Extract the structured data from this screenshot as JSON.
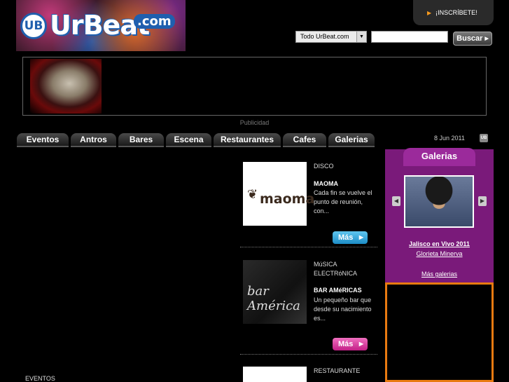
{
  "header": {
    "logo_badge": "UB",
    "logo_word": "UrBeat",
    "logo_com": ".com",
    "signup_label": "¡INSCRÍBETE!",
    "search_scope": "Todo UrBeat.com",
    "search_value": "",
    "search_button": "Buscar"
  },
  "ad": {
    "label": "Publicidad"
  },
  "nav": {
    "tabs": [
      "Eventos",
      "Antros",
      "Bares",
      "Escena",
      "Restaurantes",
      "Cafes",
      "Galerias"
    ],
    "date": "8 Jun 2011",
    "date_icon": "UB"
  },
  "listings": [
    {
      "category": "DISCO",
      "name": "MAOMA",
      "description": "Cada fin se vuelve el punto de reunión, con...",
      "thumb_text": "maoma",
      "more_label": "Más",
      "more_color": "#1d8cc6"
    },
    {
      "category_line1": "MúSICA",
      "category_line2": "ELECTRóNICA",
      "name": "BAR AMéRICAS",
      "description": "Un pequeño bar que desde su nacimiento es...",
      "thumb_text": "bar América",
      "more_label": "Más",
      "more_color": "#c21f86"
    },
    {
      "category": "RESTAURANTE"
    }
  ],
  "left": {
    "section_label": "EVENTOS"
  },
  "gallery": {
    "header": "Galerias",
    "title": "Jalisco en Vivo 2011",
    "subtitle": "Glorieta Minerva",
    "more": "Más galerias",
    "accent": "#7a1a7a"
  }
}
